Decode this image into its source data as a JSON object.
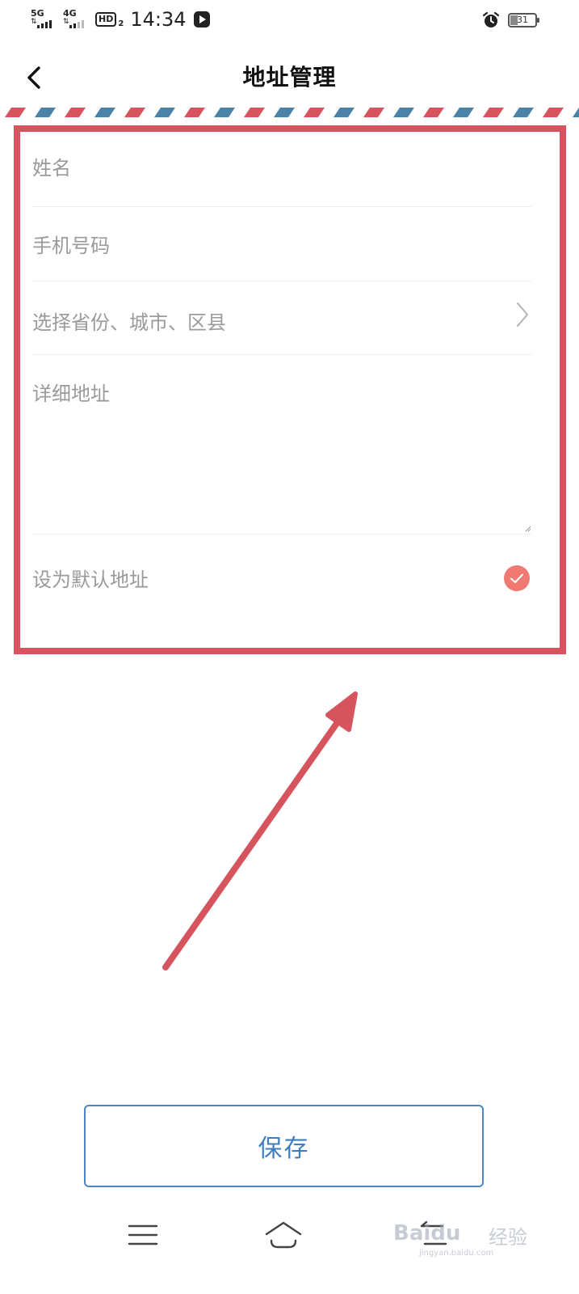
{
  "status_bar": {
    "network_1": "5G",
    "network_2": "4G",
    "hd_label": "HD",
    "hd_sub": "2",
    "time": "14:34",
    "battery_level": 31,
    "battery_text": "31"
  },
  "header": {
    "title": "地址管理",
    "back_icon": "chevron-left-icon"
  },
  "form": {
    "name_placeholder": "姓名",
    "phone_placeholder": "手机号码",
    "region_placeholder": "选择省份、城市、区县",
    "detail_placeholder": "详细地址",
    "default_label": "设为默认地址",
    "default_checked": true
  },
  "save_button": {
    "label": "保存"
  },
  "watermark": {
    "logo": "Baidu",
    "logo_cn": "经验",
    "url": "jingyan.baidu.com"
  },
  "colors": {
    "annotation_red": "#d6545e",
    "check_red": "#f07a72",
    "accent_blue": "#3d7fc1",
    "stripe_red": "#d6545e",
    "stripe_blue": "#4a82a8"
  }
}
